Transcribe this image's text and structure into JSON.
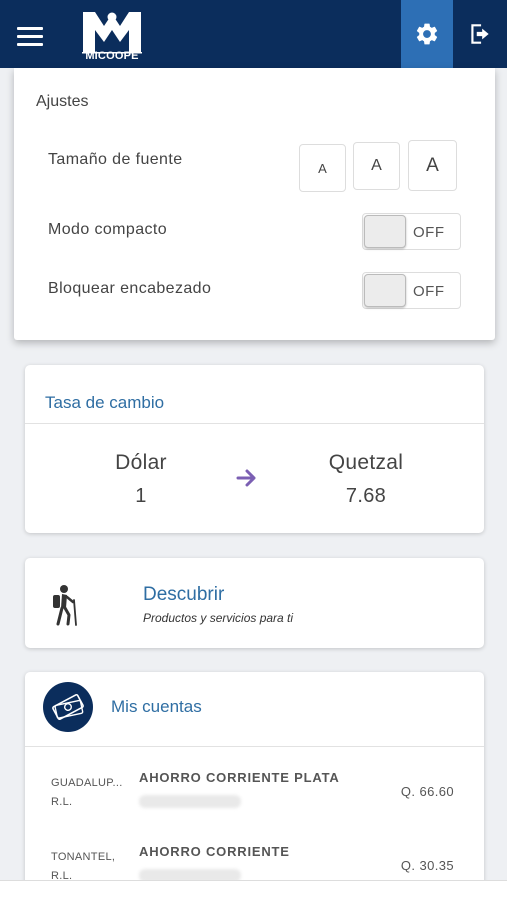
{
  "header": {
    "logo_text": "MICOOPE",
    "brand_color": "#0b2d5c",
    "accent_color": "#2d6fb5",
    "menu_icon": "hamburger-menu-icon",
    "settings_icon": "gear-icon",
    "logout_icon": "logout-icon"
  },
  "settings": {
    "title": "Ajustes",
    "font_size_label": "Tamaño de fuente",
    "font_sizes": [
      "A",
      "A",
      "A"
    ],
    "compact_label": "Modo compacto",
    "compact_state": "OFF",
    "lock_header_label": "Bloquear encabezado",
    "lock_header_state": "OFF"
  },
  "exchange": {
    "title": "Tasa de cambio",
    "from_currency": "Dólar",
    "from_value": "1",
    "to_currency": "Quetzal",
    "to_value": "7.68",
    "arrow_icon": "arrow-right-icon",
    "arrow_color": "#7b5fb3"
  },
  "discover": {
    "title": "Descubrir",
    "subtitle": "Productos y servicios para ti",
    "icon": "hiker-icon"
  },
  "accounts": {
    "title": "Mis cuentas",
    "icon": "money-icon",
    "items": [
      {
        "bank_line1": "GUADALUP...",
        "bank_line2": "R.L.",
        "name": "AHORRO CORRIENTE PLATA",
        "amount": "Q. 66.60"
      },
      {
        "bank_line1": "TONANTEL,",
        "bank_line2": "R.L.",
        "name": "AHORRO CORRIENTE",
        "amount": "Q. 30.35"
      }
    ]
  }
}
